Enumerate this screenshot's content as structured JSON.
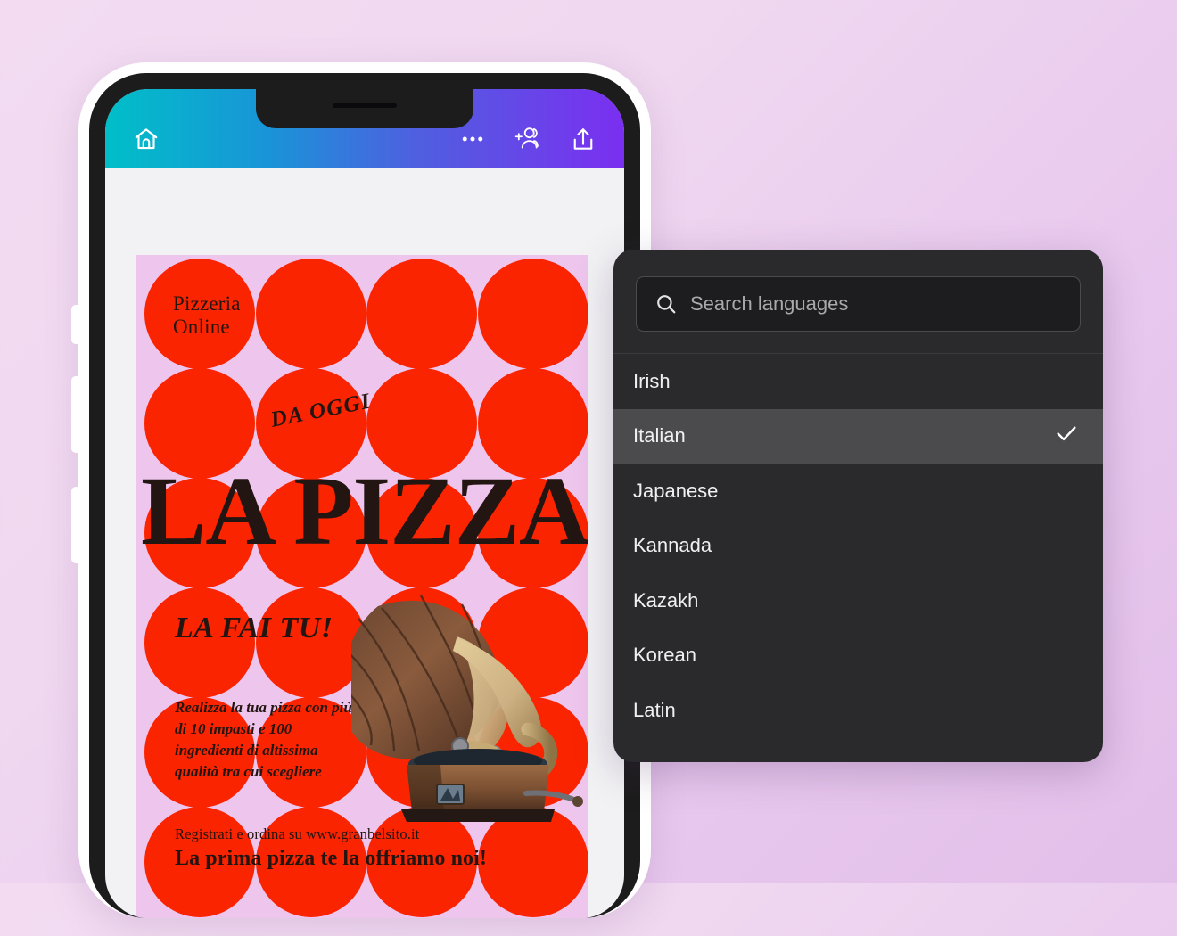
{
  "background": {
    "gradient_from": "#f3dcf2",
    "gradient_to": "#e2bfe9"
  },
  "phone": {
    "frame_color": "#ffffff",
    "bezel_color": "#1c1c1c",
    "screen_color": "#f2f2f4",
    "side_buttons": [
      "silent-switch",
      "volume-up",
      "volume-down"
    ],
    "topbar": {
      "gradient_from": "#00bfc8",
      "gradient_mid": "#4f5fe0",
      "gradient_to": "#7b2ff0",
      "icons": [
        {
          "name": "home-icon",
          "label": "Home"
        },
        {
          "name": "more-options-icon",
          "label": "More options"
        },
        {
          "name": "add-collaborator-icon",
          "label": "Add people"
        },
        {
          "name": "share-icon",
          "label": "Share"
        }
      ]
    }
  },
  "poster": {
    "background_color": "#eec5ed",
    "circle_color": "#fa2400",
    "text_color": "#231512",
    "brand_line_1": "Pizzeria",
    "brand_line_2": "Online",
    "badge": "DA OGGI",
    "headline": "LA PIZZA",
    "subhead": "LA FAI TU!",
    "body": "Realizza la tua pizza con più di 10 impasti e 100 ingredienti di altissima qualità tra cui scegliere",
    "register_line": "Registrati e ordina su www.granbelsito.it",
    "cta_line": "La prima pizza te la offriamo noi!",
    "illustration": "gramophone"
  },
  "language_dropdown": {
    "panel_color": "#2a2a2d",
    "selected_row_color": "#4b4b4e",
    "search": {
      "placeholder": "Search languages",
      "value": "",
      "icon": "search-icon"
    },
    "items": [
      {
        "label": "Irish",
        "selected": false
      },
      {
        "label": "Italian",
        "selected": true
      },
      {
        "label": "Japanese",
        "selected": false
      },
      {
        "label": "Kannada",
        "selected": false
      },
      {
        "label": "Kazakh",
        "selected": false
      },
      {
        "label": "Korean",
        "selected": false
      },
      {
        "label": "Latin",
        "selected": false
      }
    ],
    "check_icon": "check-icon"
  }
}
